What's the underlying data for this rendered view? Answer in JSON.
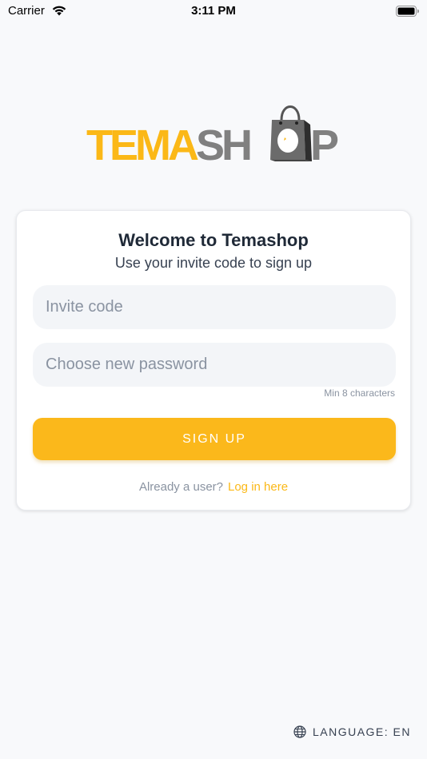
{
  "status_bar": {
    "carrier": "Carrier",
    "time": "3:11 PM",
    "wifi_icon": "wifi-icon",
    "battery_icon": "battery-icon"
  },
  "logo": {
    "part1": "TEMA",
    "part2": "SH",
    "part3": "P",
    "brand_color": "#fbb817",
    "secondary_color": "#808080",
    "bag_icon": "shopping-bag-icon"
  },
  "card": {
    "title": "Welcome to Temashop",
    "subtitle": "Use your invite code to sign up",
    "invite_placeholder": "Invite code",
    "password_placeholder": "Choose new password",
    "password_hint": "Min 8 characters",
    "signup_label": "SIGN UP",
    "login_prompt": "Already a user?",
    "login_link": "Log in here"
  },
  "language": {
    "label": "LANGUAGE: EN",
    "icon": "globe-icon"
  },
  "colors": {
    "accent": "#fbb81b",
    "background": "#f8f9fb",
    "input_bg": "#f3f5f8"
  }
}
